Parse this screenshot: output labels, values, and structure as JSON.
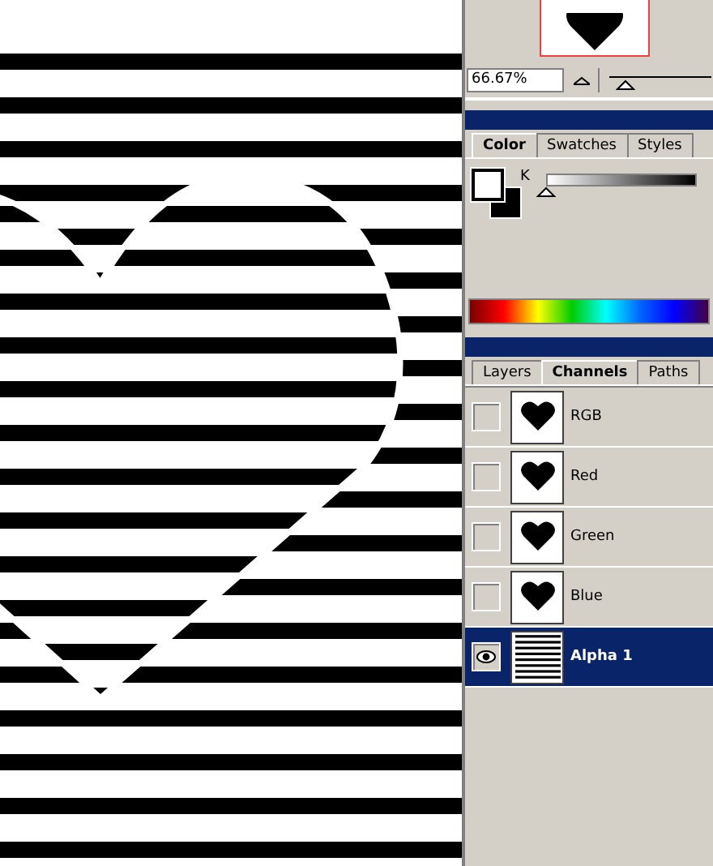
{
  "navigator": {
    "zoom": "66.67%",
    "level": 0.15
  },
  "color_panel": {
    "tabs": [
      {
        "label": "Color",
        "selected": true
      },
      {
        "label": "Swatches",
        "selected": false
      },
      {
        "label": "Styles",
        "selected": false
      }
    ],
    "slider": {
      "label": "K",
      "level": 0
    }
  },
  "channels_panel": {
    "tabs": [
      {
        "label": "Layers",
        "selected": false
      },
      {
        "label": "Channels",
        "selected": true
      },
      {
        "label": "Paths",
        "selected": false
      }
    ],
    "channels": [
      {
        "name": "RGB",
        "kind": "color",
        "visible": false,
        "selected": false
      },
      {
        "name": "Red",
        "kind": "color",
        "visible": false,
        "selected": false
      },
      {
        "name": "Green",
        "kind": "color",
        "visible": false,
        "selected": false
      },
      {
        "name": "Blue",
        "kind": "color",
        "visible": false,
        "selected": false
      },
      {
        "name": "Alpha 1",
        "kind": "alpha",
        "visible": true,
        "selected": true
      }
    ]
  }
}
